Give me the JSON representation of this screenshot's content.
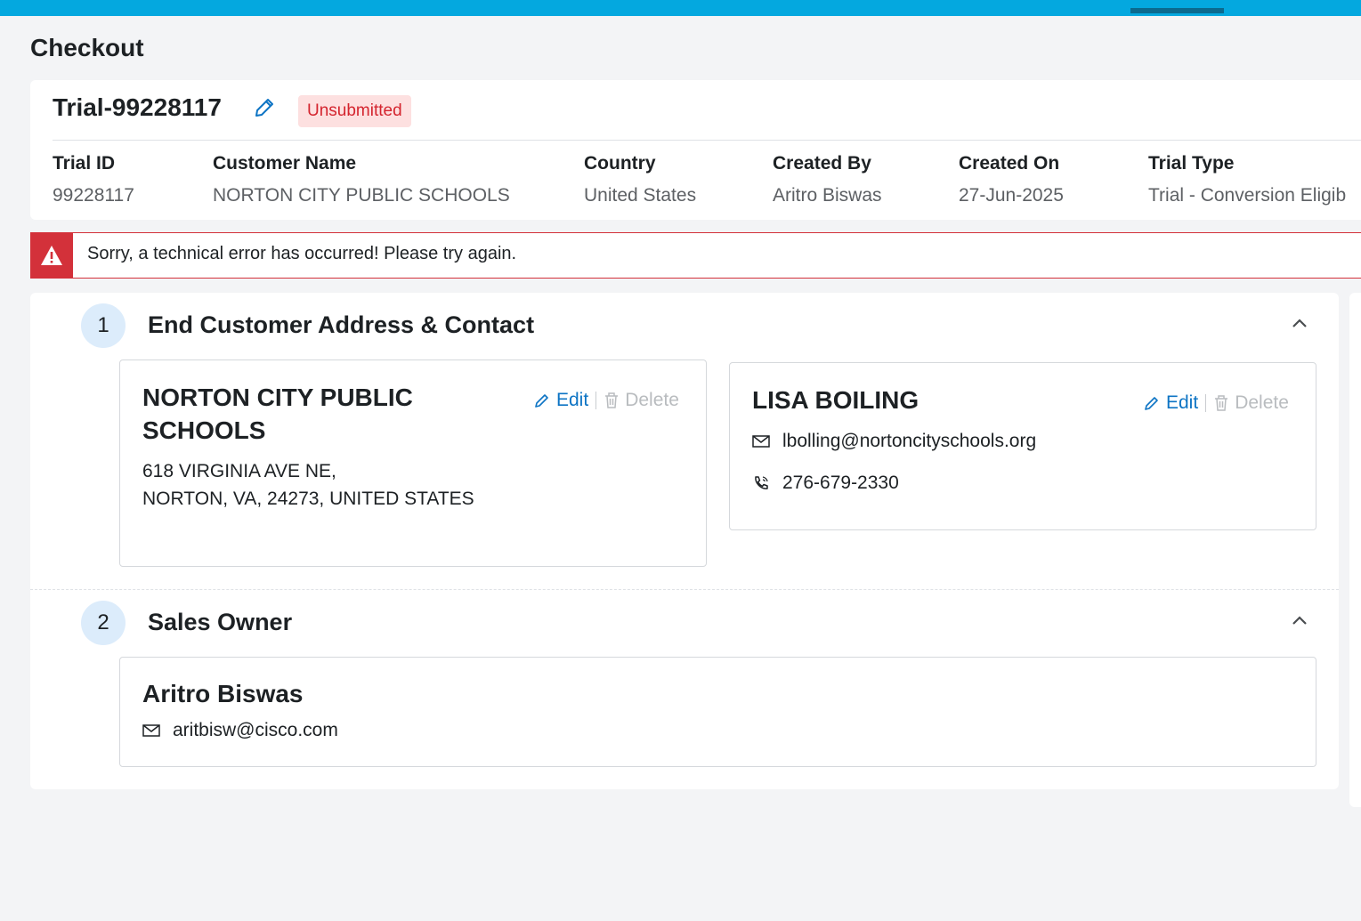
{
  "page": {
    "title": "Checkout"
  },
  "trial": {
    "heading": "Trial-99228117",
    "status": "Unsubmitted",
    "fields": [
      {
        "label": "Trial ID",
        "value": "99228117"
      },
      {
        "label": "Customer Name",
        "value": "NORTON CITY PUBLIC SCHOOLS"
      },
      {
        "label": "Country",
        "value": "United States"
      },
      {
        "label": "Created By",
        "value": "Aritro Biswas"
      },
      {
        "label": "Created On",
        "value": "27-Jun-2025"
      },
      {
        "label": "Trial Type",
        "value": "Trial - Conversion Eligib"
      }
    ]
  },
  "alert": {
    "message": "Sorry, a technical error has occurred! Please try again."
  },
  "steps": [
    {
      "number": "1",
      "title": "End Customer Address & Contact",
      "address": {
        "name_line1": "NORTON CITY PUBLIC",
        "name_line2": "SCHOOLS",
        "line1": "618 VIRGINIA AVE NE,",
        "line2": "NORTON, VA, 24273, UNITED STATES",
        "edit_label": "Edit",
        "delete_label": "Delete"
      },
      "contact": {
        "name": "LISA BOILING",
        "email": "lbolling@nortoncityschools.org",
        "phone": "276-679-2330",
        "edit_label": "Edit",
        "delete_label": "Delete"
      }
    },
    {
      "number": "2",
      "title": "Sales Owner",
      "owner": {
        "name": "Aritro Biswas",
        "email": "aritbisw@cisco.com"
      }
    }
  ],
  "colors": {
    "topbar": "#04a8df",
    "link": "#0d74c4",
    "error": "#d3313a",
    "badge_bg": "#fde0e0",
    "step_circle": "#dcecfb"
  }
}
